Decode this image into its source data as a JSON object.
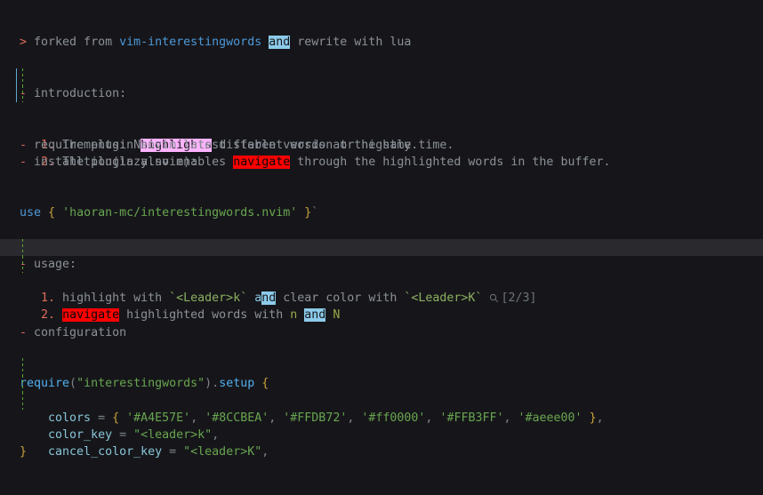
{
  "window": {
    "app": "neovim",
    "background_color": "#16161a",
    "cursorline_color": "#2a2a2e"
  },
  "highlight_groups": {
    "cyan": "#8CCBEA",
    "pink": "#FFB3FF",
    "red": "#ff0000",
    "green": "#A4E57E",
    "yellow": "#FFDB72",
    "olive": "#aeee00"
  },
  "search": {
    "icon": "search-icon",
    "count_label": "[2/3]",
    "current": 2,
    "total": 3
  },
  "document": {
    "line01": {
      "prompt": ">",
      "text_a": " forked from ",
      "link": "vim-interestingwords",
      "text_b": " ",
      "match": "and",
      "text_c": " rewrite with lua"
    },
    "line04": {
      "bullet": "-",
      "text": " introduction:"
    },
    "line05": {
      "number": "1.",
      "text_a": " The plugin ",
      "match": "highlights",
      "text_b": " different words at the same time."
    },
    "line06": {
      "number": "2.",
      "text_a": " The plugin also enables ",
      "match": "navigate",
      "text_b": " through the highlighted words in the buffer."
    },
    "line07": {
      "bullet": "-",
      "text": " requirements: Neovim latest stable version or nightly."
    },
    "line08": {
      "bullet": "-",
      "text": " installtion(lazy.nvim):"
    },
    "line11": {
      "keyword": "use",
      "brace_open": " { ",
      "string": "'haoran-mc/interestingwords.nvim'",
      "brace_close": " }",
      "backtick": "`"
    },
    "line14": {
      "bullet": "-",
      "text": " usage:"
    },
    "line15": {
      "number": "1.",
      "text_a": " highlight with ",
      "key_a": "`<Leader>k`",
      "text_b": " ",
      "match_head": "a",
      "match_tail": "nd",
      "text_c": " clear color with ",
      "key_b": "`<Leader>K`"
    },
    "line16": {
      "number": "2.",
      "text_a": " ",
      "match_a": "navigate",
      "text_b": " highlighted words with ",
      "key_n": "n",
      "text_c": " ",
      "match_b": "and",
      "text_d": " ",
      "key_N": "N"
    },
    "line18": {
      "bullet": "-",
      "text": " configuration"
    },
    "line21": {
      "func": "require",
      "paren_open": "(",
      "module": "\"interestingwords\"",
      "paren_close": ")",
      "dot": ".",
      "method": "setup",
      "brace": " {"
    },
    "line22": {
      "key": "colors",
      "eq": " = ",
      "brace_open": "{ ",
      "colors": [
        "'#A4E57E'",
        "'#8CCBEA'",
        "'#FFDB72'",
        "'#ff0000'",
        "'#FFB3FF'",
        "'#aeee00'"
      ],
      "sep": ", ",
      "brace_close": " }",
      "comma": ","
    },
    "line23": {
      "key": "color_key",
      "eq": " = ",
      "value": "\"<leader>k\"",
      "comma": ","
    },
    "line24": {
      "key": "cancel_color_key",
      "eq": " = ",
      "value": "\"<leader>K\"",
      "comma": ","
    },
    "line25": {
      "brace_close": "}"
    }
  }
}
